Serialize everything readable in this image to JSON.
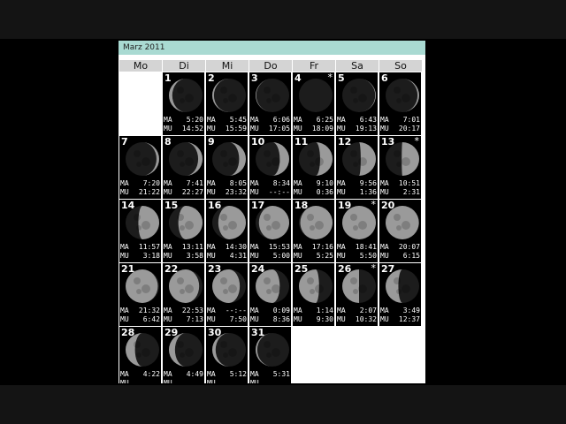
{
  "calendar": {
    "title": "Marz 2011",
    "weekdays": [
      "Mo",
      "Di",
      "Mi",
      "Do",
      "Fr",
      "Sa",
      "So"
    ],
    "rise_label": "MA",
    "set_label": "MU",
    "colors": {
      "header": "#a9dad2",
      "weekday_bg": "#d4d4d4",
      "cell_bg": "#000000"
    },
    "days": [
      {
        "day": "1",
        "ma": "5:20",
        "mu": "14:52",
        "illum": 0.1,
        "side": "left",
        "star": false
      },
      {
        "day": "2",
        "ma": "5:45",
        "mu": "15:59",
        "illum": 0.05,
        "side": "left",
        "star": false
      },
      {
        "day": "3",
        "ma": "6:06",
        "mu": "17:05",
        "illum": 0.02,
        "side": "left",
        "star": false
      },
      {
        "day": "4",
        "ma": "6:25",
        "mu": "18:09",
        "illum": 0.0,
        "side": "left",
        "star": true
      },
      {
        "day": "5",
        "ma": "6:43",
        "mu": "19:13",
        "illum": 0.02,
        "side": "right",
        "star": false
      },
      {
        "day": "6",
        "ma": "7:01",
        "mu": "20:17",
        "illum": 0.05,
        "side": "right",
        "star": false
      },
      {
        "day": "7",
        "ma": "7:20",
        "mu": "21:22",
        "illum": 0.08,
        "side": "right",
        "star": false
      },
      {
        "day": "8",
        "ma": "7:41",
        "mu": "22:27",
        "illum": 0.13,
        "side": "right",
        "star": false
      },
      {
        "day": "9",
        "ma": "8:05",
        "mu": "23:32",
        "illum": 0.2,
        "side": "right",
        "star": false
      },
      {
        "day": "10",
        "ma": "8:34",
        "mu": "--:--",
        "illum": 0.28,
        "side": "right",
        "star": false
      },
      {
        "day": "11",
        "ma": "9:10",
        "mu": "0:36",
        "illum": 0.37,
        "side": "right",
        "star": false
      },
      {
        "day": "12",
        "ma": "9:56",
        "mu": "1:36",
        "illum": 0.45,
        "side": "right",
        "star": false
      },
      {
        "day": "13",
        "ma": "10:51",
        "mu": "2:31",
        "illum": 0.52,
        "side": "right",
        "star": true
      },
      {
        "day": "14",
        "ma": "11:57",
        "mu": "3:18",
        "illum": 0.62,
        "side": "right",
        "star": false
      },
      {
        "day": "15",
        "ma": "13:11",
        "mu": "3:58",
        "illum": 0.72,
        "side": "right",
        "star": false
      },
      {
        "day": "16",
        "ma": "14:30",
        "mu": "4:31",
        "illum": 0.82,
        "side": "right",
        "star": false
      },
      {
        "day": "17",
        "ma": "15:53",
        "mu": "5:00",
        "illum": 0.9,
        "side": "right",
        "star": false
      },
      {
        "day": "18",
        "ma": "17:16",
        "mu": "5:25",
        "illum": 0.96,
        "side": "right",
        "star": false
      },
      {
        "day": "19",
        "ma": "18:41",
        "mu": "5:50",
        "illum": 1.0,
        "side": "right",
        "star": true
      },
      {
        "day": "20",
        "ma": "20:07",
        "mu": "6:15",
        "illum": 0.99,
        "side": "left",
        "star": false
      },
      {
        "day": "21",
        "ma": "21:32",
        "mu": "6:42",
        "illum": 0.96,
        "side": "left",
        "star": false
      },
      {
        "day": "22",
        "ma": "22:53",
        "mu": "7:13",
        "illum": 0.9,
        "side": "left",
        "star": false
      },
      {
        "day": "23",
        "ma": "--:--",
        "mu": "7:50",
        "illum": 0.82,
        "side": "left",
        "star": false
      },
      {
        "day": "24",
        "ma": "0:09",
        "mu": "8:36",
        "illum": 0.72,
        "side": "left",
        "star": false
      },
      {
        "day": "25",
        "ma": "1:14",
        "mu": "9:30",
        "illum": 0.6,
        "side": "left",
        "star": false
      },
      {
        "day": "26",
        "ma": "2:07",
        "mu": "10:32",
        "illum": 0.5,
        "side": "left",
        "star": true
      },
      {
        "day": "27",
        "ma": "3:49",
        "mu": "12:37",
        "illum": 0.38,
        "side": "left",
        "star": false
      },
      {
        "day": "28",
        "ma": "4:22",
        "mu": "",
        "illum": 0.28,
        "side": "left",
        "star": false
      },
      {
        "day": "29",
        "ma": "4:49",
        "mu": "",
        "illum": 0.18,
        "side": "left",
        "star": false
      },
      {
        "day": "30",
        "ma": "5:12",
        "mu": "",
        "illum": 0.1,
        "side": "left",
        "star": false
      },
      {
        "day": "31",
        "ma": "5:31",
        "mu": "",
        "illum": 0.05,
        "side": "left",
        "star": false
      }
    ]
  }
}
